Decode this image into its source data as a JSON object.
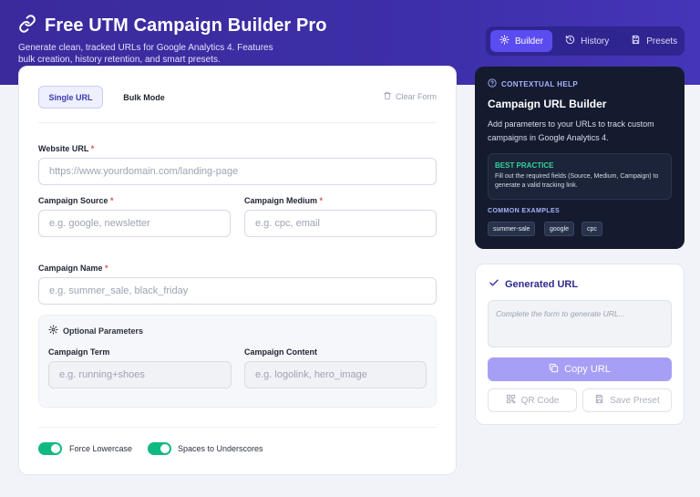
{
  "app": {
    "title": "Free UTM Campaign Builder Pro",
    "subtitle": "Generate clean, tracked URLs for Google Analytics 4. Features bulk creation, history retention, and smart presets.",
    "logo_icon": "link-icon",
    "header_color": "#3a2a9c"
  },
  "nav": {
    "tabs": [
      {
        "label": "Builder",
        "icon": "gear-icon",
        "active": true
      },
      {
        "label": "History",
        "icon": "history-icon",
        "active": false
      },
      {
        "label": "Presets",
        "icon": "save-icon",
        "active": false
      }
    ]
  },
  "form": {
    "modes": {
      "single": "Single URL",
      "bulk": "Bulk Mode"
    },
    "clear_label": "Clear Form",
    "website_url": {
      "label": "Website URL",
      "required": "*",
      "placeholder": "https://www.yourdomain.com/landing-page",
      "value": ""
    },
    "source": {
      "label": "Campaign Source",
      "required": "*",
      "placeholder": "e.g. google, newsletter",
      "value": ""
    },
    "medium": {
      "label": "Campaign Medium",
      "required": "*",
      "placeholder": "e.g. cpc, email",
      "value": ""
    },
    "name": {
      "label": "Campaign Name",
      "required": "*",
      "placeholder": "e.g. summer_sale, black_friday",
      "value": ""
    },
    "optional": {
      "title": "Optional Parameters",
      "term": {
        "label": "Campaign Term",
        "placeholder": "e.g. running+shoes",
        "value": ""
      },
      "content": {
        "label": "Campaign Content",
        "placeholder": "e.g. logolink, hero_image",
        "value": ""
      }
    },
    "toggles": [
      {
        "label": "Force Lowercase",
        "on": true
      },
      {
        "label": "Spaces to Underscores",
        "on": true
      }
    ],
    "toggle_color": "#10b981"
  },
  "help": {
    "tag": "CONTEXTUAL HELP",
    "title": "Campaign URL Builder",
    "description": "Add parameters to your URLs to track custom campaigns in Google Analytics 4.",
    "practice_title": "BEST PRACTICE",
    "practice_text": "Fill out the required fields (Source, Medium, Campaign) to generate a valid tracking link.",
    "examples_title": "COMMON EXAMPLES",
    "examples": [
      "summer-sale",
      "google",
      "cpc"
    ]
  },
  "generated": {
    "title": "Generated URL",
    "placeholder": "Complete the form to generate URL...",
    "copy_label": "Copy URL",
    "qr_label": "QR Code",
    "save_label": "Save Preset",
    "accent": "#a79ff5"
  }
}
